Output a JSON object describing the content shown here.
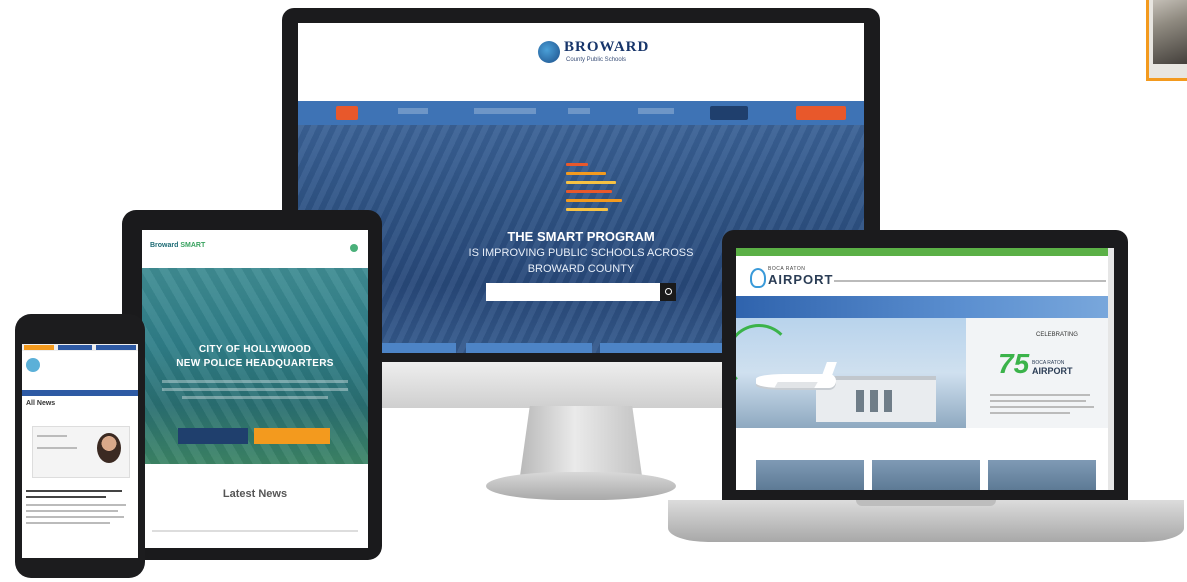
{
  "monitor_site": {
    "logo_name": "BROWARD",
    "logo_sub": "County Public Schools",
    "tagline": "",
    "nav": [
      "",
      "",
      "",
      "",
      ""
    ],
    "hero_title": "THE SMART PROGRAM",
    "hero_lines": [
      "IS IMPROVING PUBLIC SCHOOLS ACROSS",
      "BROWARD COUNTY"
    ],
    "search_placeholder": "",
    "smart_logo_colors": [
      "#e8582b",
      "#f39a1e",
      "#f7c243",
      "#e8582b",
      "#f39a1e",
      "#f7c243"
    ],
    "brand_blue": "#3e73b5",
    "accent_orange": "#e8582b"
  },
  "tablet_site": {
    "logo": "Broward",
    "logo_accent": "SMART",
    "hero_title": [
      "CITY OF HOLLYWOOD",
      "NEW POLICE HEADQUARTERS"
    ],
    "buttons": [
      "",
      ""
    ],
    "news_heading": "Latest News",
    "theme_teal": "#2f7e88"
  },
  "phone_site": {
    "section_title": "All News"
  },
  "laptop_site": {
    "logo_top": "BOCA RATON",
    "logo": "AIRPORT",
    "band_text": "",
    "celebrating": "CELEBRATING",
    "anniversary_number": "75",
    "anniversary_name": "BOCA RATON",
    "anniversary_word": "AIRPORT",
    "section_heading": "",
    "brand_green": "#5bb046"
  }
}
